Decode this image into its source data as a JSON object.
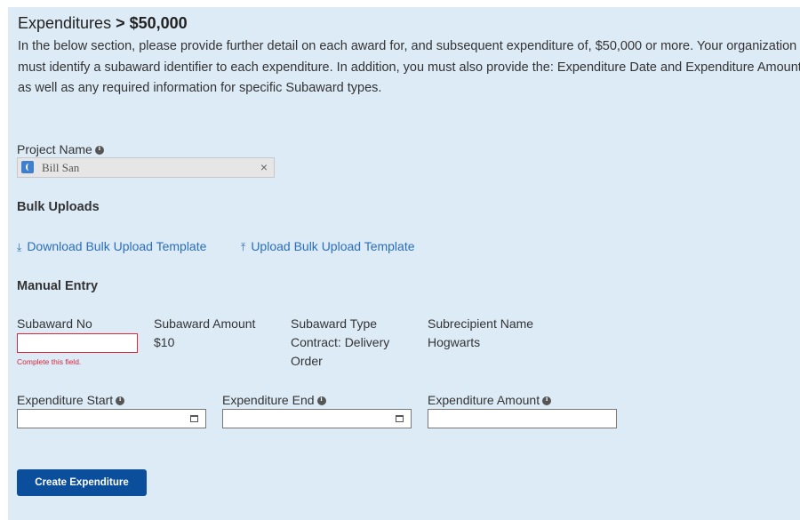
{
  "page": {
    "title_prefix": "Expenditures",
    "title_suffix": "> $50,000",
    "intro": "In the below section, please provide further detail on each award for, and subsequent expenditure of, $50,000 or more. Your organization must identify a subaward identifier to each expenditure. In addition, you must also provide the: Expenditure Date and Expenditure Amount, as well as any required information for specific Subaward types."
  },
  "project": {
    "label": "Project Name",
    "selected": "Bill San",
    "clear_symbol": "×"
  },
  "bulk": {
    "heading": "Bulk Uploads",
    "download_label": "Download Bulk Upload Template",
    "upload_label": "Upload Bulk Upload Template"
  },
  "manual": {
    "heading": "Manual Entry",
    "subaward_no_label": "Subaward No",
    "subaward_no_value": "",
    "subaward_no_error": "Complete this field.",
    "subaward_amount_label": "Subaward Amount",
    "subaward_amount_value": "$10",
    "subaward_type_label": "Subaward Type",
    "subaward_type_value": "Contract: Delivery Order",
    "subrecipient_label": "Subrecipient Name",
    "subrecipient_value": "Hogwarts"
  },
  "expenditure": {
    "start_label": "Expenditure Start",
    "end_label": "Expenditure End",
    "amount_label": "Expenditure Amount",
    "start_value": "",
    "end_value": "",
    "amount_value": ""
  },
  "actions": {
    "create_label": "Create Expenditure"
  },
  "icons": {
    "download": "download-icon",
    "upload": "upload-icon",
    "calendar": "calendar-icon",
    "info": "info-icon"
  },
  "colors": {
    "panel_bg": "#ddebf7",
    "link": "#2a6ebb",
    "error": "#d22a3c",
    "primary_button": "#0b4f9c"
  }
}
